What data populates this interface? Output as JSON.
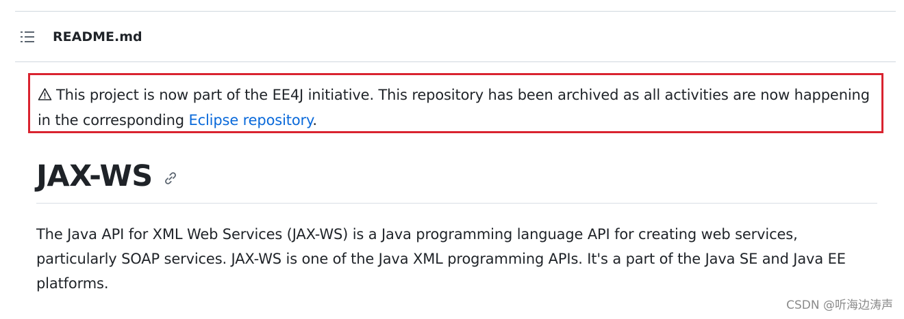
{
  "file_header": {
    "filename": "README.md",
    "outline_icon": "list-unordered-icon"
  },
  "notice": {
    "icon": "warning-icon",
    "text_before": "This project is now part of the EE4J initiative. This repository has been archived as all activities are now happening in the corresponding ",
    "link_text": "Eclipse repository",
    "text_after": "."
  },
  "heading": {
    "title": "JAX-WS",
    "anchor_icon": "link-icon"
  },
  "body": {
    "paragraph": "The Java API for XML Web Services (JAX-WS) is a Java programming language API for creating web services, particularly SOAP services. JAX-WS is one of the Java XML programming APIs. It's a part of the Java SE and Java EE platforms."
  },
  "watermark": {
    "text": "CSDN @听海边涛声"
  },
  "colors": {
    "highlight_border": "#d9232f",
    "link": "#0969da",
    "text": "#1f2328",
    "divider": "#d0d7de"
  }
}
